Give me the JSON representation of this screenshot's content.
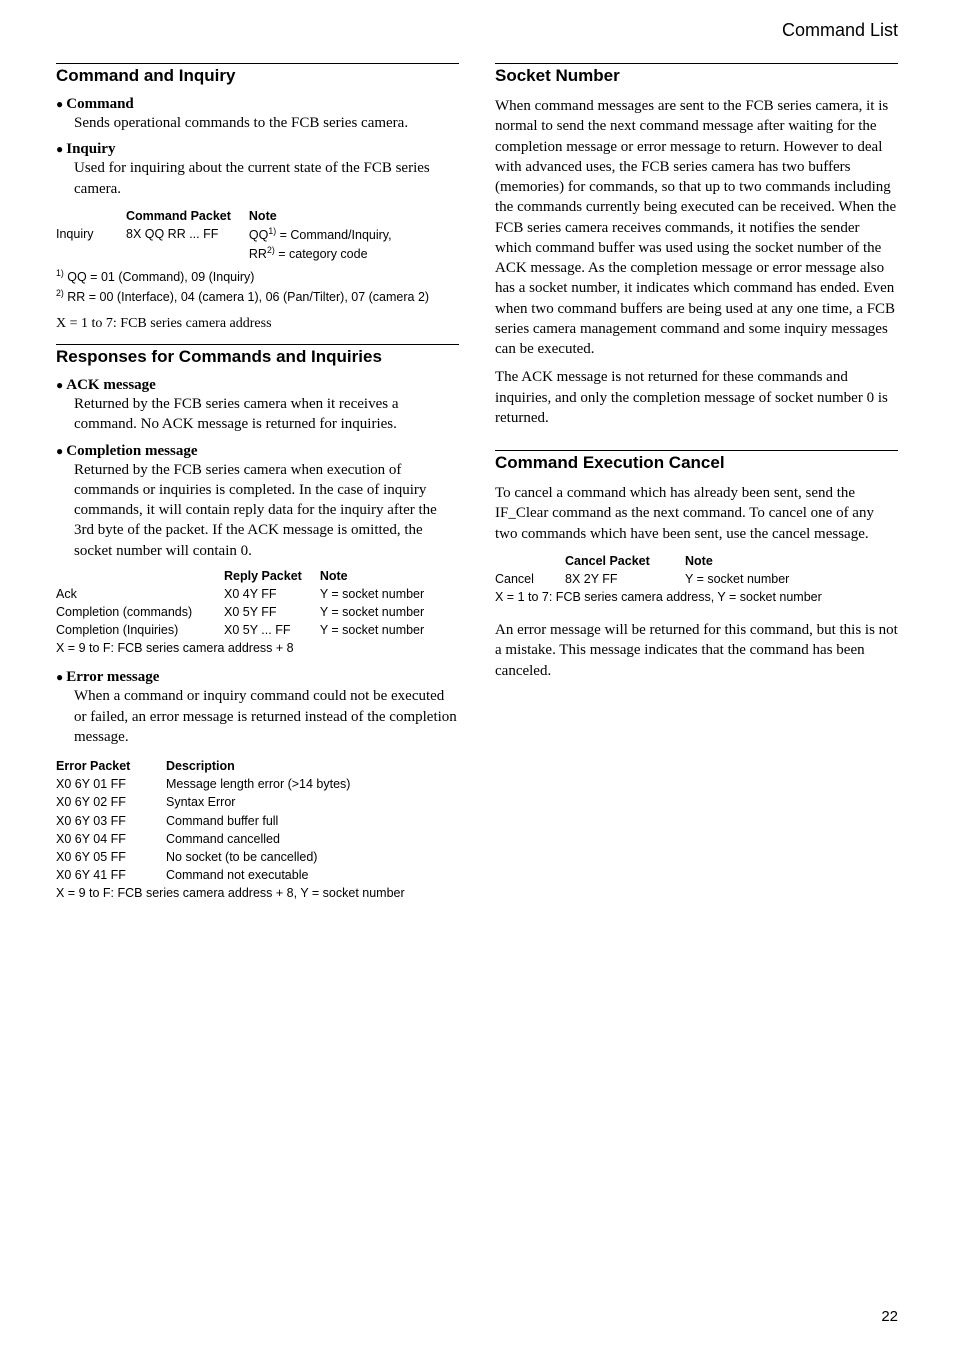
{
  "header": {
    "doc_section": "Command List"
  },
  "left": {
    "s1": {
      "title": "Command and Inquiry",
      "b1": {
        "h": "Command",
        "p": "Sends operational commands to the FCB series camera."
      },
      "b2": {
        "h": "Inquiry",
        "p": "Used for inquiring about the current state of the FCB series camera."
      },
      "tbl": {
        "h1": "Command Packet",
        "h2": "Note",
        "r1c0": "Inquiry",
        "r1c1": "8X QQ RR ... FF",
        "r1c2a": "QQ",
        "r1c2b": " = Command/Inquiry,",
        "r1c3a": "RR",
        "r1c3b": " = category code"
      },
      "fn1a": "1)",
      "fn1b": " QQ = 01 (Command), 09 (Inquiry)",
      "fn2a": "2)",
      "fn2b": " RR = 00 (Interface), 04 (camera 1), 06 (Pan/Tilter), 07 (camera 2)",
      "note": "X = 1 to 7: FCB series camera address"
    },
    "s2": {
      "title": "Responses for Commands and Inquiries",
      "b1": {
        "h": "ACK message",
        "p": "Returned by the FCB series camera when it receives a command. No ACK message is returned for inquiries."
      },
      "b2": {
        "h": "Completion message",
        "p": "Returned by the FCB series camera when execution of commands or inquiries is completed. In the case of inquiry commands, it will contain reply data for the inquiry after the 3rd byte of the packet. If the ACK message is omitted, the socket number will contain 0."
      },
      "tbl": {
        "h1": "Reply Packet",
        "h2": "Note",
        "r1c0": "Ack",
        "r1c1": "X0 4Y FF",
        "r1c2": "Y = socket number",
        "r2c0": "Completion (commands)",
        "r2c1": "X0 5Y FF",
        "r2c2": "Y = socket number",
        "r3c0": "Completion (Inquiries)",
        "r3c1": "X0 5Y ... FF",
        "r3c2": "Y = socket number",
        "foot": "X = 9 to F: FCB series camera address + 8"
      },
      "b3": {
        "h": "Error message",
        "p": "When a command or inquiry command could not be executed or failed, an error message is returned instead of the completion message."
      },
      "err": {
        "h1": "Error Packet",
        "h2": "Description",
        "r1a": "X0 6Y 01 FF",
        "r1b": "Message length error (>14 bytes)",
        "r2a": "X0 6Y 02 FF",
        "r2b": "Syntax Error",
        "r3a": "X0 6Y 03 FF",
        "r3b": "Command buffer full",
        "r4a": "X0 6Y 04 FF",
        "r4b": "Command cancelled",
        "r5a": "X0 6Y 05 FF",
        "r5b": "No socket (to be cancelled)",
        "r6a": "X0 6Y 41 FF",
        "r6b": "Command not executable",
        "foot": "X = 9 to F: FCB series camera address + 8, Y = socket number"
      }
    }
  },
  "right": {
    "s1": {
      "title": "Socket Number",
      "p1": "When command messages are sent to the FCB series camera, it is normal to send the next command message after waiting for the completion message or error message to return. However to deal with advanced uses, the FCB series camera has two buffers (memories) for commands, so that up to two commands including the commands currently being executed can be received. When the FCB series camera receives commands, it notifies the sender which command buffer was used using the socket number of the ACK message. As the completion message or error message also has a socket number, it indicates which command has ended. Even when two command buffers are being used at any one time, a FCB series camera management command and some inquiry messages can be executed.",
      "p2": "The ACK message is not returned for these commands and inquiries, and only the completion message of socket number 0 is returned."
    },
    "s2": {
      "title": "Command Execution Cancel",
      "p1": "To cancel a command which has already been sent, send the IF_Clear command as the next command. To cancel one of any two commands which have been sent, use the cancel message.",
      "tbl": {
        "h1": "Cancel Packet",
        "h2": "Note",
        "r1c0": "Cancel",
        "r1c1": "8X 2Y FF",
        "r1c2": "Y = socket number",
        "foot": "X = 1 to 7: FCB series camera address, Y = socket number"
      },
      "p2": "An error message will be returned for this command, but this is not a mistake. This message indicates that the command has been canceled."
    }
  },
  "page": "22"
}
